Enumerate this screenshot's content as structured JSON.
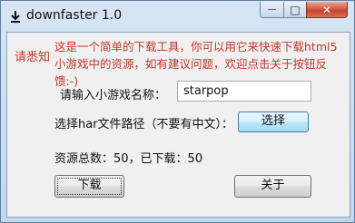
{
  "window": {
    "title": "downfaster 1.0",
    "icon": "download-arrow-icon",
    "minimize_glyph": "—",
    "maximize_glyph": "□",
    "close_glyph": "✕"
  },
  "notice": {
    "label": "请悉知",
    "text": "这是一个简单的下载工具，你可以用它来快速下载html5小游戏中的资源，如有建议问题，欢迎点击关于按钮反馈:-)"
  },
  "form": {
    "game_name_label": "请输入小游戏名称：",
    "game_name_value": "starpop",
    "har_path_label": "选择har文件路径（不要有中文）：",
    "select_button": "选择"
  },
  "status": {
    "text": "资源总数：50，已下载：50"
  },
  "buttons": {
    "download": "下载",
    "about": "关于"
  },
  "colors": {
    "notice_text": "#c0392b",
    "close_button": "#c7432d"
  }
}
